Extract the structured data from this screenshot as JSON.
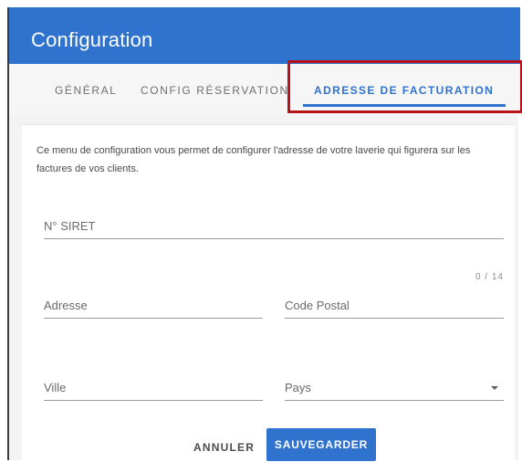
{
  "window": {
    "title": "Configuration"
  },
  "tabs": [
    {
      "label": "GÉNÉRAL",
      "active": false
    },
    {
      "label": "CONFIG RÉSERVATION",
      "active": false
    },
    {
      "label": "ADRESSE DE FACTURATION",
      "active": true
    }
  ],
  "form": {
    "description": "Ce menu de configuration vous permet de configurer l'adresse de votre laverie qui figurera sur les factures de vos clients.",
    "siret": {
      "label": "N° SIRET",
      "counter": "0 / 14",
      "value": ""
    },
    "adresse": {
      "label": "Adresse",
      "value": ""
    },
    "code_postal": {
      "label": "Code Postal",
      "value": ""
    },
    "ville": {
      "label": "Ville",
      "value": ""
    },
    "pays": {
      "label": "Pays",
      "value": ""
    }
  },
  "actions": {
    "cancel_label": "ANNULER",
    "save_label": "SAUVEGARDER"
  },
  "colors": {
    "primary": "#2f73cf",
    "highlight": "#b8121a"
  }
}
